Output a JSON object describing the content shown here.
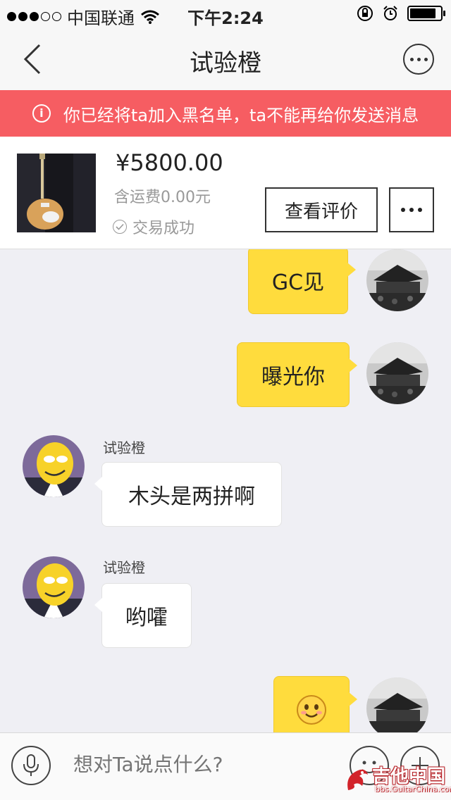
{
  "status_bar": {
    "carrier": "中国联通",
    "time": "下午2:24"
  },
  "nav": {
    "title": "试验橙"
  },
  "banner": {
    "text": "你已经将ta加入黑名单，ta不能再给你发送消息"
  },
  "product": {
    "price": "¥5800.00",
    "shipping": "含运费0.00元",
    "status": "交易成功",
    "review_button": "查看评价"
  },
  "messages": [
    {
      "from": "me",
      "text": "GC见"
    },
    {
      "from": "me",
      "text": "曝光你"
    },
    {
      "from": "them",
      "sender": "试验橙",
      "text": "木头是两拼啊"
    },
    {
      "from": "them",
      "sender": "试验橙",
      "text": "哟嚯"
    },
    {
      "from": "me",
      "type": "emoji",
      "icon": "smiley-emoji-icon"
    }
  ],
  "input": {
    "placeholder": "想对Ta说点什么?"
  },
  "watermark": {
    "main": "吉他中国",
    "sub": "bbs.GuitarChina.com"
  },
  "colors": {
    "banner": "#f65d62",
    "my_bubble": "#ffdc3d",
    "their_bubble": "#ffffff",
    "background": "#efeff4"
  }
}
